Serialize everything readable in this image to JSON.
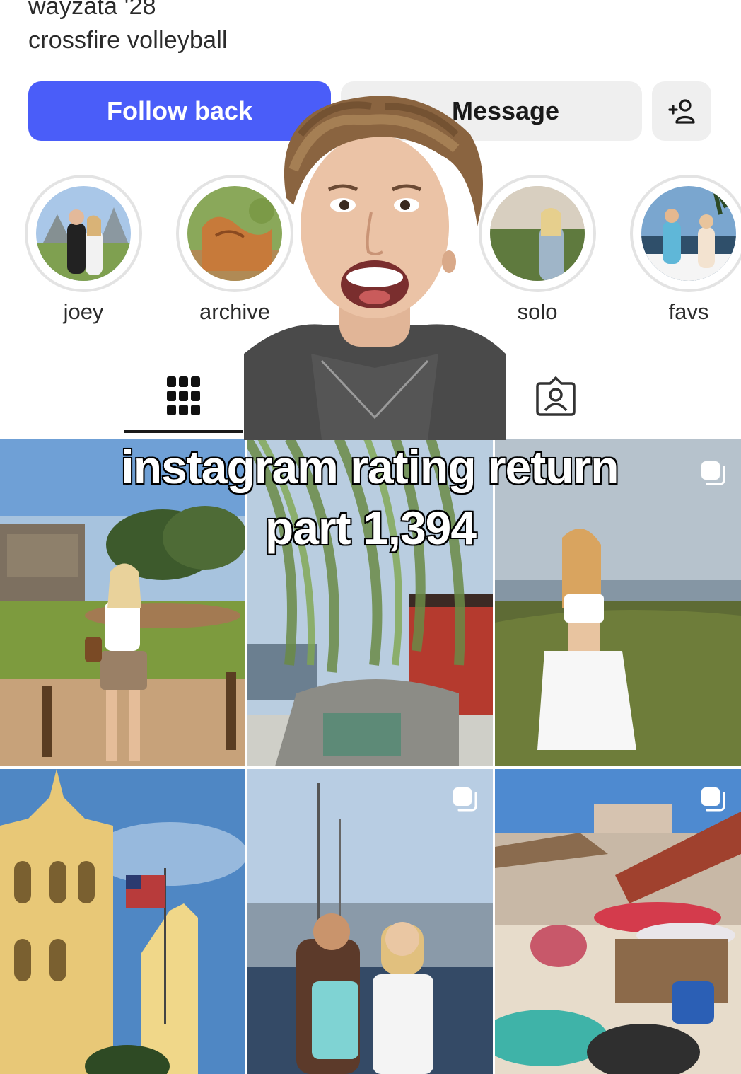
{
  "profile": {
    "bio_line_1": "wayzata '28",
    "bio_line_2": "crossfire volleyball"
  },
  "actions": {
    "follow_back_label": "Follow back",
    "message_label": "Message",
    "add_person_icon": "add-person-icon"
  },
  "highlights": [
    {
      "label": "joey"
    },
    {
      "label": "archive"
    },
    {
      "label": "solo"
    },
    {
      "label": "favs"
    }
  ],
  "tabs": {
    "grid_icon": "grid-icon",
    "tagged_icon": "tagged-person-icon",
    "active": "grid"
  },
  "overlay": {
    "caption_line_1": "instagram rating return",
    "caption_line_2": "part 1,394"
  },
  "colors": {
    "accent": "#4a5df9",
    "secondary_button": "#efefef"
  }
}
